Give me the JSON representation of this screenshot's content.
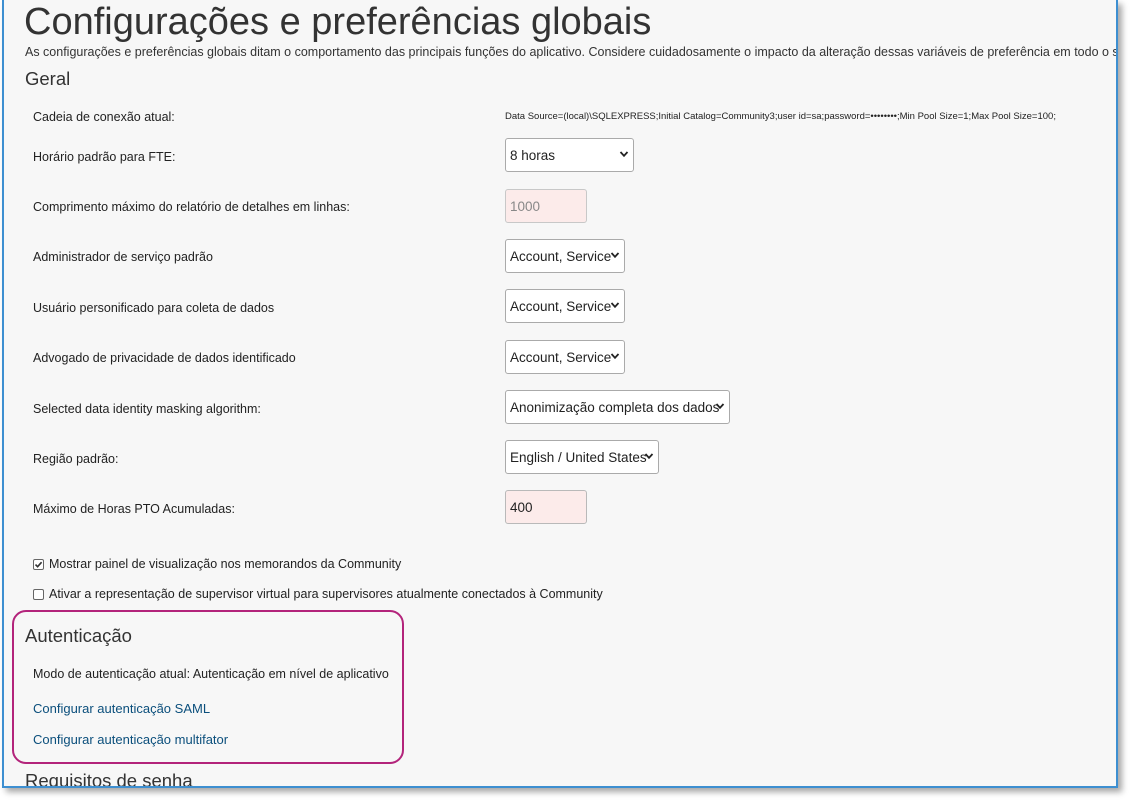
{
  "page": {
    "title": "Configurações e preferências globais",
    "description": "As configurações e preferências globais ditam o comportamento das principais funções do aplicativo. Considere cuidadosamente o impacto da alteração dessas variáveis de preferência em todo o sistema."
  },
  "general": {
    "heading": "Geral",
    "connection": {
      "label": "Cadeia de conexão atual:",
      "value": "Data Source=(local)\\SQLEXPRESS;Initial Catalog=Community3;user id=sa;password=••••••••;Min Pool Size=1;Max Pool Size=100;"
    },
    "fte_hours": {
      "label": "Horário padrão para FTE:",
      "value": "8 horas"
    },
    "max_report_length": {
      "label": "Comprimento máximo do relatório de detalhes em linhas:",
      "value": "1000"
    },
    "default_service_admin": {
      "label": "Administrador de serviço padrão",
      "value": "Account, Service"
    },
    "impersonated_user": {
      "label": "Usuário personificado para coleta de dados",
      "value": "Account, Service"
    },
    "privacy_advocate": {
      "label": "Advogado de privacidade de dados identificado",
      "value": "Account, Service"
    },
    "masking_algorithm": {
      "label": "Selected data identity masking algorithm:",
      "value": "Anonimização completa dos dados"
    },
    "default_region": {
      "label": "Região padrão:",
      "value": "English / United States"
    },
    "max_pto_hours": {
      "label": "Máximo de Horas PTO Acumuladas:",
      "value": "400"
    },
    "checkbox_preview": {
      "label": "Mostrar painel de visualização nos memorandos da Community",
      "checked": true
    },
    "checkbox_virtual_supervisor": {
      "label": "Ativar a representação de supervisor virtual para supervisores atualmente conectados à Community",
      "checked": false
    }
  },
  "authentication": {
    "heading": "Autenticação",
    "mode_text": "Modo de autenticação atual: Autenticação em nível de aplicativo",
    "saml_link": "Configurar autenticação SAML",
    "mfa_link": "Configurar autenticação multifator",
    "highlight_color": "#b3247b"
  },
  "password": {
    "heading": "Requisitos de senha"
  },
  "icons": {
    "select_arrow": "chevron-down-icon",
    "checkbox_check": "checkmark-icon"
  }
}
